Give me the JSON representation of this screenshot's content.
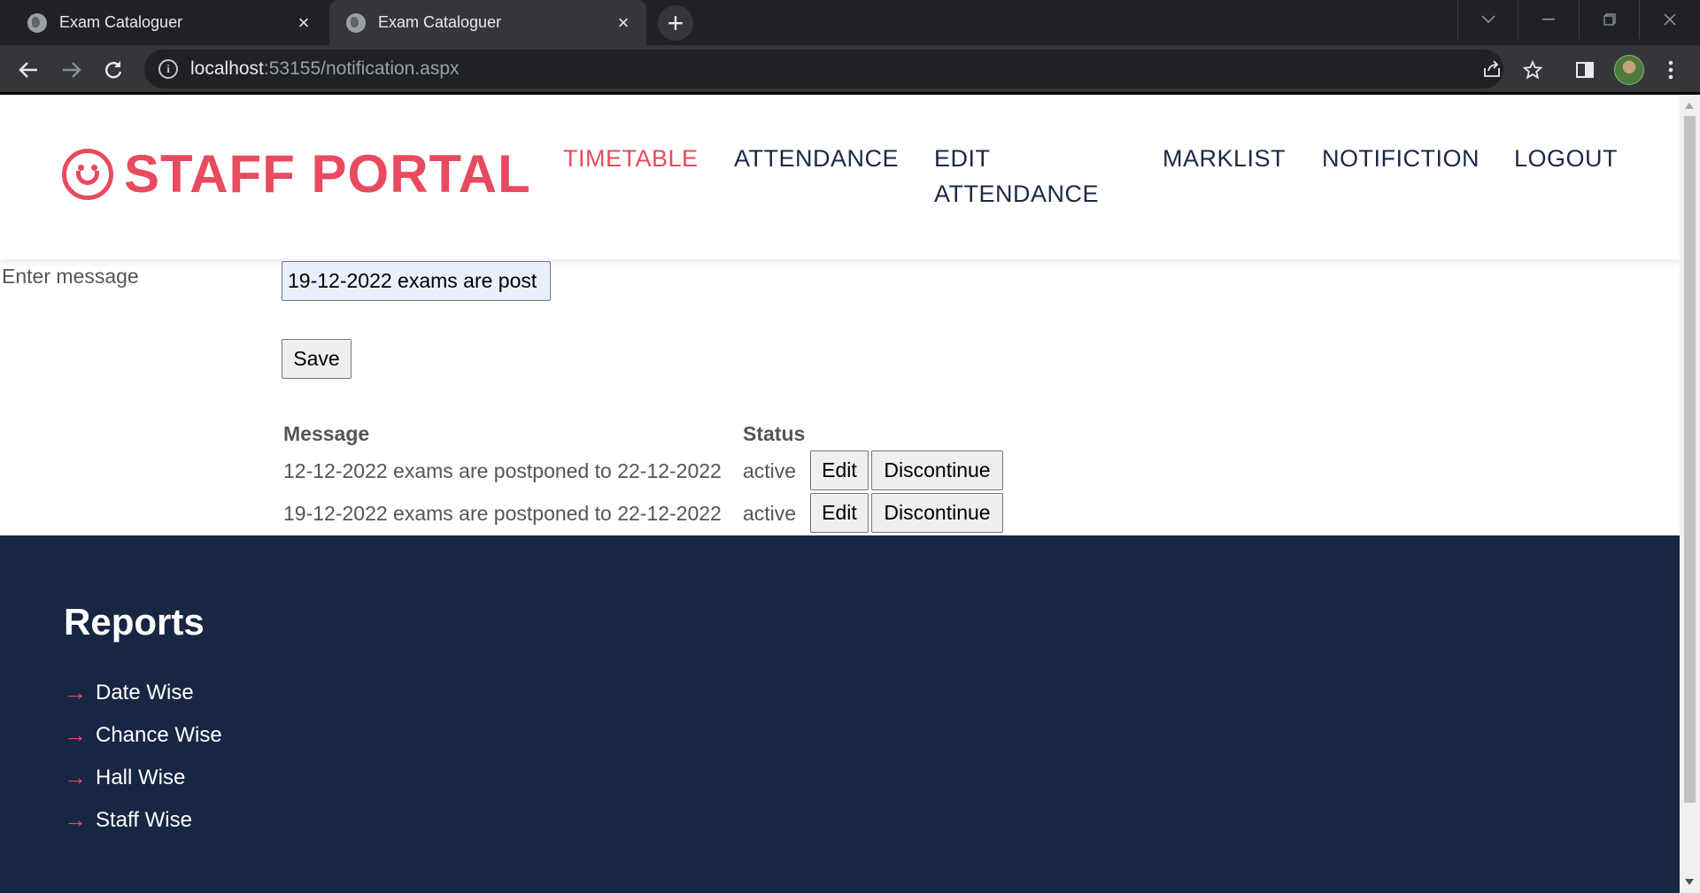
{
  "browser": {
    "tabs": [
      {
        "title": "Exam Cataloguer",
        "active": false
      },
      {
        "title": "Exam Cataloguer",
        "active": true
      }
    ],
    "url_host": "localhost",
    "url_rest": ":53155/notification.aspx"
  },
  "header": {
    "logo_text": "STAFF PORTAL",
    "nav": [
      {
        "label": "TIMETABLE",
        "active": true
      },
      {
        "label": "ATTENDANCE",
        "active": false
      },
      {
        "label_line1": "EDIT",
        "label_line2": "ATTENDANCE",
        "active": false
      },
      {
        "label": "MARKLIST",
        "active": false
      },
      {
        "label": "NOTIFICTION",
        "active": false
      },
      {
        "label": "LOGOUT",
        "active": false
      }
    ]
  },
  "form": {
    "label": "Enter message",
    "input_value": "19-12-2022 exams are post",
    "save_label": "Save"
  },
  "table": {
    "headers": {
      "message": "Message",
      "status": "Status"
    },
    "rows": [
      {
        "message": "12-12-2022 exams are postponed to 22-12-2022",
        "status": "active",
        "edit": "Edit",
        "discontinue": "Discontinue"
      },
      {
        "message": "19-12-2022 exams are postponed to 22-12-2022",
        "status": "active",
        "edit": "Edit",
        "discontinue": "Discontinue"
      }
    ]
  },
  "footer": {
    "title": "Reports",
    "links": [
      "Date Wise",
      "Chance Wise",
      "Hall Wise",
      "Staff Wise"
    ]
  },
  "colors": {
    "accent": "#e84a5f",
    "nav_text": "#1b2a44",
    "footer_bg": "#172643"
  }
}
